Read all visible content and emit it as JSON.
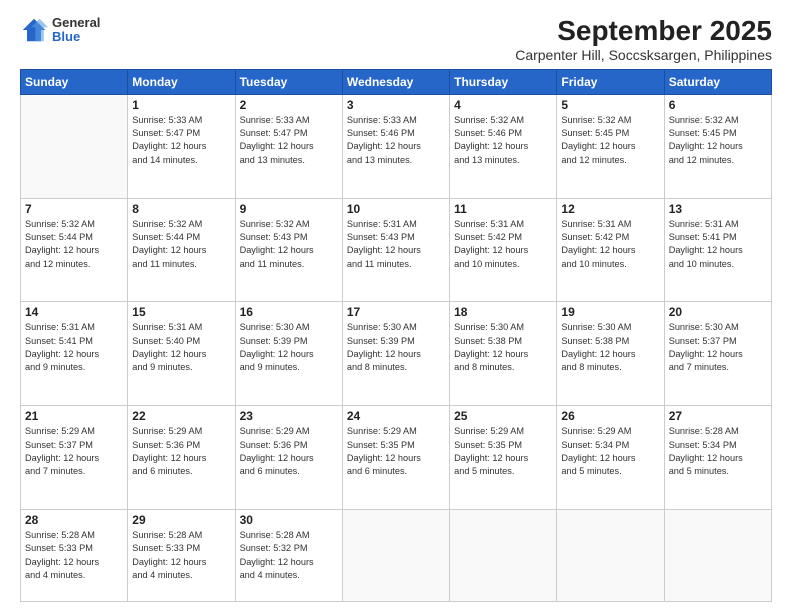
{
  "header": {
    "logo": {
      "general": "General",
      "blue": "Blue"
    },
    "title": "September 2025",
    "subtitle": "Carpenter Hill, Soccsksargen, Philippines"
  },
  "weekdays": [
    "Sunday",
    "Monday",
    "Tuesday",
    "Wednesday",
    "Thursday",
    "Friday",
    "Saturday"
  ],
  "weeks": [
    [
      {
        "day": "",
        "info": ""
      },
      {
        "day": "1",
        "info": "Sunrise: 5:33 AM\nSunset: 5:47 PM\nDaylight: 12 hours\nand 14 minutes."
      },
      {
        "day": "2",
        "info": "Sunrise: 5:33 AM\nSunset: 5:47 PM\nDaylight: 12 hours\nand 13 minutes."
      },
      {
        "day": "3",
        "info": "Sunrise: 5:33 AM\nSunset: 5:46 PM\nDaylight: 12 hours\nand 13 minutes."
      },
      {
        "day": "4",
        "info": "Sunrise: 5:32 AM\nSunset: 5:46 PM\nDaylight: 12 hours\nand 13 minutes."
      },
      {
        "day": "5",
        "info": "Sunrise: 5:32 AM\nSunset: 5:45 PM\nDaylight: 12 hours\nand 12 minutes."
      },
      {
        "day": "6",
        "info": "Sunrise: 5:32 AM\nSunset: 5:45 PM\nDaylight: 12 hours\nand 12 minutes."
      }
    ],
    [
      {
        "day": "7",
        "info": "Sunrise: 5:32 AM\nSunset: 5:44 PM\nDaylight: 12 hours\nand 12 minutes."
      },
      {
        "day": "8",
        "info": "Sunrise: 5:32 AM\nSunset: 5:44 PM\nDaylight: 12 hours\nand 11 minutes."
      },
      {
        "day": "9",
        "info": "Sunrise: 5:32 AM\nSunset: 5:43 PM\nDaylight: 12 hours\nand 11 minutes."
      },
      {
        "day": "10",
        "info": "Sunrise: 5:31 AM\nSunset: 5:43 PM\nDaylight: 12 hours\nand 11 minutes."
      },
      {
        "day": "11",
        "info": "Sunrise: 5:31 AM\nSunset: 5:42 PM\nDaylight: 12 hours\nand 10 minutes."
      },
      {
        "day": "12",
        "info": "Sunrise: 5:31 AM\nSunset: 5:42 PM\nDaylight: 12 hours\nand 10 minutes."
      },
      {
        "day": "13",
        "info": "Sunrise: 5:31 AM\nSunset: 5:41 PM\nDaylight: 12 hours\nand 10 minutes."
      }
    ],
    [
      {
        "day": "14",
        "info": "Sunrise: 5:31 AM\nSunset: 5:41 PM\nDaylight: 12 hours\nand 9 minutes."
      },
      {
        "day": "15",
        "info": "Sunrise: 5:31 AM\nSunset: 5:40 PM\nDaylight: 12 hours\nand 9 minutes."
      },
      {
        "day": "16",
        "info": "Sunrise: 5:30 AM\nSunset: 5:39 PM\nDaylight: 12 hours\nand 9 minutes."
      },
      {
        "day": "17",
        "info": "Sunrise: 5:30 AM\nSunset: 5:39 PM\nDaylight: 12 hours\nand 8 minutes."
      },
      {
        "day": "18",
        "info": "Sunrise: 5:30 AM\nSunset: 5:38 PM\nDaylight: 12 hours\nand 8 minutes."
      },
      {
        "day": "19",
        "info": "Sunrise: 5:30 AM\nSunset: 5:38 PM\nDaylight: 12 hours\nand 8 minutes."
      },
      {
        "day": "20",
        "info": "Sunrise: 5:30 AM\nSunset: 5:37 PM\nDaylight: 12 hours\nand 7 minutes."
      }
    ],
    [
      {
        "day": "21",
        "info": "Sunrise: 5:29 AM\nSunset: 5:37 PM\nDaylight: 12 hours\nand 7 minutes."
      },
      {
        "day": "22",
        "info": "Sunrise: 5:29 AM\nSunset: 5:36 PM\nDaylight: 12 hours\nand 6 minutes."
      },
      {
        "day": "23",
        "info": "Sunrise: 5:29 AM\nSunset: 5:36 PM\nDaylight: 12 hours\nand 6 minutes."
      },
      {
        "day": "24",
        "info": "Sunrise: 5:29 AM\nSunset: 5:35 PM\nDaylight: 12 hours\nand 6 minutes."
      },
      {
        "day": "25",
        "info": "Sunrise: 5:29 AM\nSunset: 5:35 PM\nDaylight: 12 hours\nand 5 minutes."
      },
      {
        "day": "26",
        "info": "Sunrise: 5:29 AM\nSunset: 5:34 PM\nDaylight: 12 hours\nand 5 minutes."
      },
      {
        "day": "27",
        "info": "Sunrise: 5:28 AM\nSunset: 5:34 PM\nDaylight: 12 hours\nand 5 minutes."
      }
    ],
    [
      {
        "day": "28",
        "info": "Sunrise: 5:28 AM\nSunset: 5:33 PM\nDaylight: 12 hours\nand 4 minutes."
      },
      {
        "day": "29",
        "info": "Sunrise: 5:28 AM\nSunset: 5:33 PM\nDaylight: 12 hours\nand 4 minutes."
      },
      {
        "day": "30",
        "info": "Sunrise: 5:28 AM\nSunset: 5:32 PM\nDaylight: 12 hours\nand 4 minutes."
      },
      {
        "day": "",
        "info": ""
      },
      {
        "day": "",
        "info": ""
      },
      {
        "day": "",
        "info": ""
      },
      {
        "day": "",
        "info": ""
      }
    ]
  ]
}
